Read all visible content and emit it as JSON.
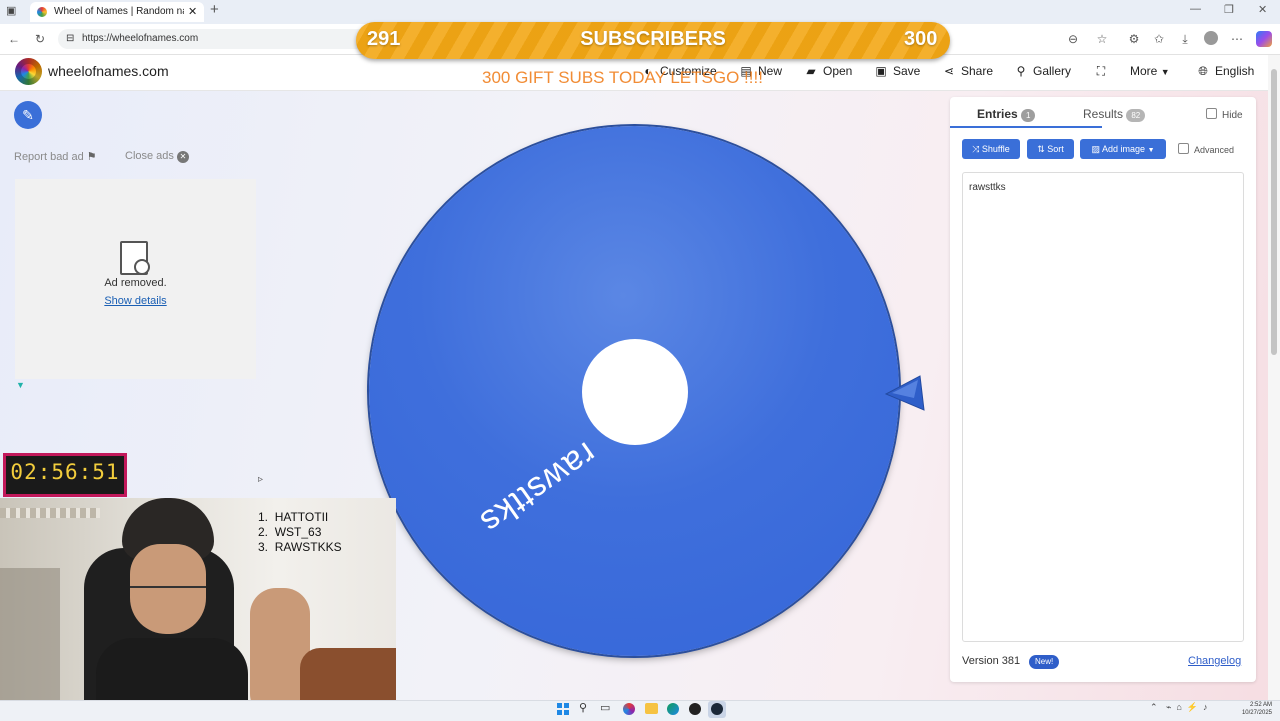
{
  "browser": {
    "tab_title": "Wheel of Names | Random name",
    "new_tab": "+",
    "url": "https://wheelofnames.com"
  },
  "site": {
    "logo_text": "wheelofnames.com",
    "nav": {
      "customize": "Customize",
      "new": "New",
      "open": "Open",
      "save": "Save",
      "share": "Share",
      "gallery": "Gallery",
      "more": "More",
      "language": "English"
    }
  },
  "ads": {
    "report": "Report bad ad",
    "close": "Close ads",
    "removed": "Ad removed.",
    "details": "Show details"
  },
  "wheel": {
    "entry": "rawsttks",
    "color": "#3f6fdc"
  },
  "panel": {
    "tab_entries": "Entries",
    "entries_count": "1",
    "tab_results": "Results",
    "results_count": "82",
    "hide": "Hide",
    "shuffle": "Shuffle",
    "sort": "Sort",
    "add_image": "Add image",
    "advanced": "Advanced",
    "entries_text": "rawsttks",
    "version": "Version 381",
    "new_badge": "New!",
    "changelog": "Changelog"
  },
  "overlay": {
    "subs_current": "291",
    "subs_label": "SUBSCRIBERS",
    "subs_goal": "300",
    "gift_text": "300 GIFT SUBS TODAY LETSGO !!!!",
    "timer": "02:56:51",
    "winners": [
      "HATTOTII",
      "WST_63",
      "RAWSTKKS"
    ]
  },
  "taskbar": {
    "time": "2:52 AM",
    "date": "10/27/2025"
  },
  "colors": {
    "accent": "#3a6fd8",
    "subs_bar": "#f3a715",
    "timer_border": "#c2185b",
    "gift_text": "#f08020"
  }
}
